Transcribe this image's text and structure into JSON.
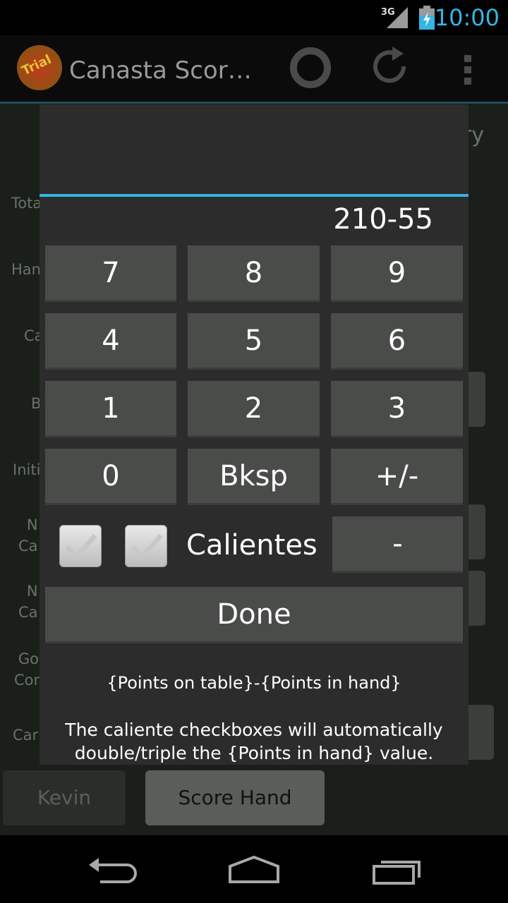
{
  "status_bar": {
    "network": "3G",
    "time": "10:00"
  },
  "action_bar": {
    "title": "Canasta Scor…",
    "logo_text": "Trial"
  },
  "background": {
    "labels": [
      "Tota",
      "Han",
      "Ca",
      "B",
      "Initi",
      "N\nCa",
      "N\nCa",
      "Go\nCon",
      "Car"
    ],
    "right_fragment": "ry",
    "tabs": {
      "player": "Kevin",
      "score_hand": "Score Hand"
    }
  },
  "dialog": {
    "display_value": "210-55",
    "keys": [
      "7",
      "8",
      "9",
      "4",
      "5",
      "6",
      "1",
      "2",
      "3",
      "0",
      "Bksp",
      "+/-"
    ],
    "calientes_label": "Calientes",
    "minus_label": "-",
    "done_label": "Done",
    "hint_format": "{Points on table}-{Points in hand}",
    "hint_description": "The caliente checkboxes will automatically double/triple the {Points in hand} value."
  }
}
